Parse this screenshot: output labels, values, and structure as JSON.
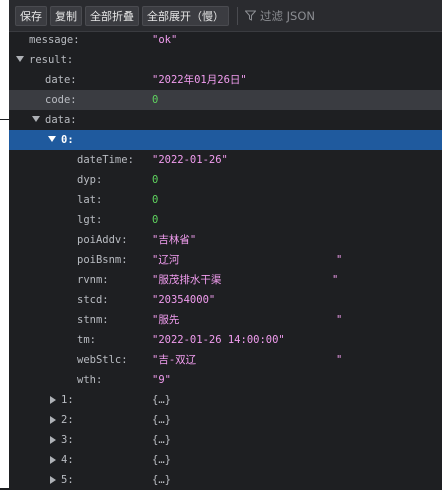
{
  "toolbar": {
    "save_label": "保存",
    "copy_label": "复制",
    "collapse_all_label": "全部折叠",
    "expand_all_label": "全部展开（慢）",
    "filter_label": "过滤 JSON"
  },
  "tree": {
    "message_key": "message:",
    "message_val": "\"ok\"",
    "result_key": "result:",
    "date_key": "date:",
    "date_val": "\"2022年01月26日\"",
    "code_key": "code:",
    "code_val": "0",
    "data_key": "data:",
    "item0_key": "0:",
    "fields": [
      {
        "key": "dateTime:",
        "val": "\"2022-01-26\"",
        "type": "str"
      },
      {
        "key": "dyp:",
        "val": "0",
        "type": "num"
      },
      {
        "key": "lat:",
        "val": "0",
        "type": "num"
      },
      {
        "key": "lgt:",
        "val": "0",
        "type": "num"
      },
      {
        "key": "poiAddv:",
        "val": "\"吉林省\"",
        "type": "str"
      },
      {
        "key": "poiBsnm:",
        "val": "\"辽河",
        "type": "str",
        "tail": "\""
      },
      {
        "key": "rvnm:",
        "val": "\"服茂排水干渠",
        "type": "str",
        "tail": "\""
      },
      {
        "key": "stcd:",
        "val": "\"20354000\"",
        "type": "str"
      },
      {
        "key": "stnm:",
        "val": "\"服先",
        "type": "str",
        "tail": "\""
      },
      {
        "key": "tm:",
        "val": "\"2022-01-26 14:00:00\"",
        "type": "str"
      },
      {
        "key": "webStlc:",
        "val": "\"吉-双辽",
        "type": "str",
        "tail": "\""
      },
      {
        "key": "wth:",
        "val": "\"9\"",
        "type": "str"
      }
    ],
    "collapsed_items": [
      {
        "key": "1:",
        "val": "{…}"
      },
      {
        "key": "2:",
        "val": "{…}"
      },
      {
        "key": "3:",
        "val": "{…}"
      },
      {
        "key": "4:",
        "val": "{…}"
      },
      {
        "key": "5:",
        "val": "{…}"
      }
    ]
  }
}
